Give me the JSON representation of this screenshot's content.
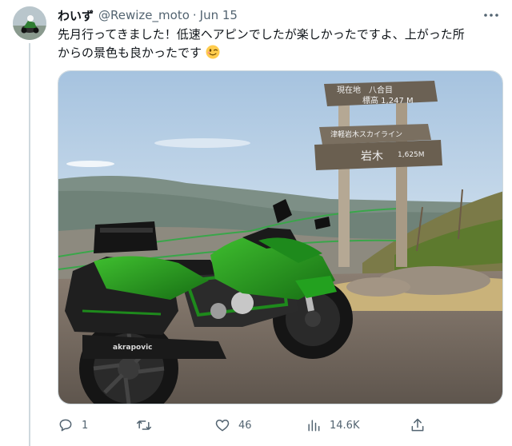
{
  "tweet": {
    "author": {
      "display_name": "わいず",
      "handle": "@Rewize_moto",
      "separator": "·",
      "date": "Jun 15"
    },
    "text_line1": "先月行ってきました！低速ヘアピンでしたが楽しかったですよ、上がった所",
    "text_line2": "からの景色も良かったです",
    "text_emoji": "winking-face",
    "media": {
      "sign": {
        "top_line1": "現在地　八合目",
        "top_line2": "標高 1,247 M",
        "mid_line1": "津軽岩木スカイライン",
        "mid_line2": "岩木",
        "mid_line3": "1,625M"
      },
      "fairing_brand": "akrapovic"
    },
    "actions": {
      "reply_count": "1",
      "retweet_count": "",
      "like_count": "46",
      "view_count": "14.6K"
    },
    "icons": [
      "more-icon",
      "reply-icon",
      "retweet-icon",
      "like-icon",
      "views-icon",
      "share-icon"
    ],
    "colors": {
      "text": "#0f1419",
      "secondary": "#536471",
      "border": "#cfd9de",
      "bike_green": "#1f8a1c"
    }
  }
}
